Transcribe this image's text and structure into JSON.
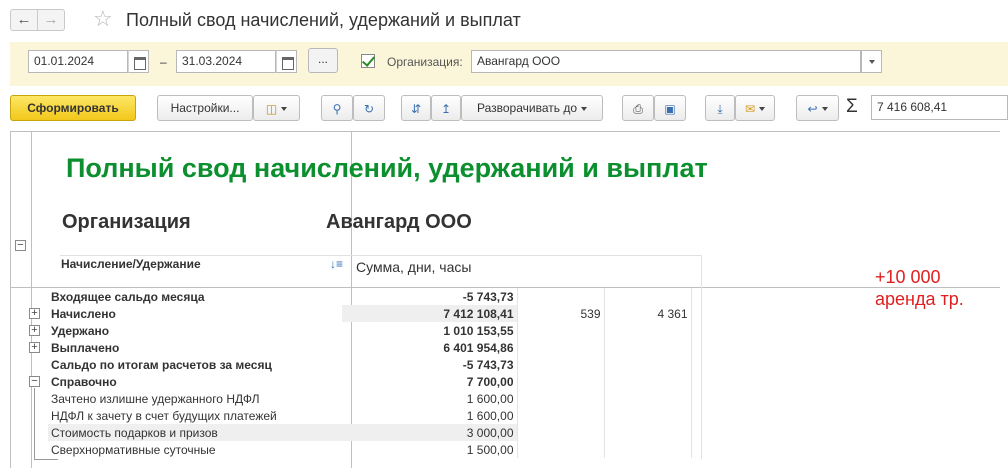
{
  "window": {
    "title": "Полный свод начислений, удержаний и выплат"
  },
  "params": {
    "date_from": "01.01.2024",
    "date_to": "31.03.2024",
    "dash": "–",
    "dots_label": "...",
    "org_label": "Организация:",
    "org_value": "Авангард ООО"
  },
  "toolbar": {
    "generate": "Сформировать",
    "settings": "Настройки...",
    "expand_to": "Разворачивать до",
    "sum_value": "7 416 608,41"
  },
  "report": {
    "title": "Полный свод начислений, удержаний и выплат",
    "org_caption": "Организация",
    "org_value": "Авангард ООО",
    "col_header": "Начисление/Удержание",
    "col_header2": "Сумма, дни, часы",
    "note_line1": "+10 000",
    "note_line2": "аренда тр.",
    "rows": [
      {
        "label": "Входящее сальдо месяца",
        "value": "-5 743,73",
        "c2": "",
        "c3": ""
      },
      {
        "label": "Начислено",
        "value": "7 412 108,41",
        "c2": "539",
        "c3": "4 361"
      },
      {
        "label": "Удержано",
        "value": "1 010 153,55",
        "c2": "",
        "c3": ""
      },
      {
        "label": "Выплачено",
        "value": "6 401 954,86",
        "c2": "",
        "c3": ""
      },
      {
        "label": "Сальдо по итогам расчетов за месяц",
        "value": "-5 743,73",
        "c2": "",
        "c3": ""
      },
      {
        "label": "Справочно",
        "value": "7 700,00",
        "c2": "",
        "c3": ""
      },
      {
        "label": "Зачтено излишне удержанного НДФЛ",
        "value": "1 600,00",
        "c2": "",
        "c3": ""
      },
      {
        "label": "НДФЛ к зачету в счет будущих платежей",
        "value": "1 600,00",
        "c2": "",
        "c3": ""
      },
      {
        "label": "Стоимость подарков и призов",
        "value": "3 000,00",
        "c2": "",
        "c3": ""
      },
      {
        "label": "Сверхнормативные суточные",
        "value": "1 500,00",
        "c2": "",
        "c3": ""
      }
    ]
  }
}
